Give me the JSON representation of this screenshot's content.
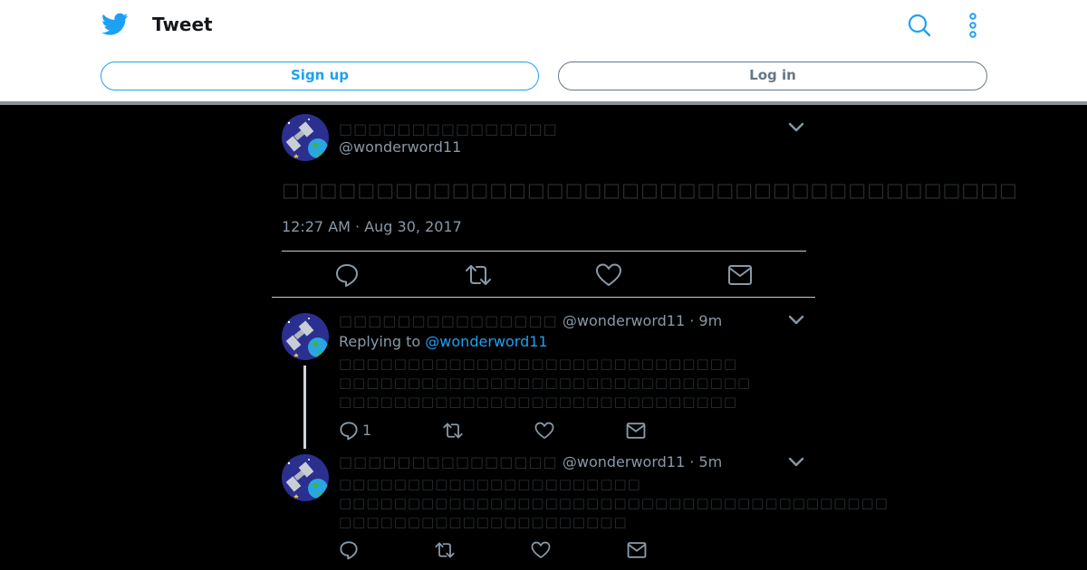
{
  "header": {
    "title": "Tweet",
    "signup_label": "Sign up",
    "login_label": "Log in"
  },
  "main_tweet": {
    "display_name": "□□□□□□□□□□□□□□□",
    "handle": "@wonderword11",
    "text": "□□□□□□□□□□□□□□□□□□□□□□□□□□□□□□□□□□□□□□□",
    "timestamp": "12:27 AM · Aug 30, 2017"
  },
  "replies": [
    {
      "display_name": "□□□□□□□□□□□□□□□",
      "handle": "@wonderword11",
      "time": "9m",
      "replying_prefix": "Replying to",
      "replying_to": "@wonderword11",
      "lines": [
        "□□□□□□□□□□□□□□□□□□□□□□□□□□□□□",
        "□□□□□□□□□□□□□□□□□□□□□□□□□□□□□□",
        "□□□□□□□□□□□□□□□□□□□□□□□□□□□□□"
      ],
      "reply_count": "1"
    },
    {
      "display_name": "□□□□□□□□□□□□□□□",
      "handle": "@wonderword11",
      "time": "5m",
      "lines": [
        "□□□□□□□□□□□□□□□□□□□□□□",
        "□□□□□□□□□□□□□□□□□□□□□□□□□□□□□□□□□□□□□□□□",
        "□□□□□□□□□□□□□□□□□□□□□"
      ]
    }
  ],
  "icons": {
    "brand": "twitter-bird-icon",
    "search": "search-icon",
    "more": "more-vertical-icon",
    "reply": "reply-icon",
    "retweet": "retweet-icon",
    "like": "like-icon",
    "message": "direct-message-icon",
    "caret": "chevron-down-icon"
  },
  "colors": {
    "accent": "#1da1f2",
    "background": "#000000",
    "muted": "#8899a6"
  }
}
